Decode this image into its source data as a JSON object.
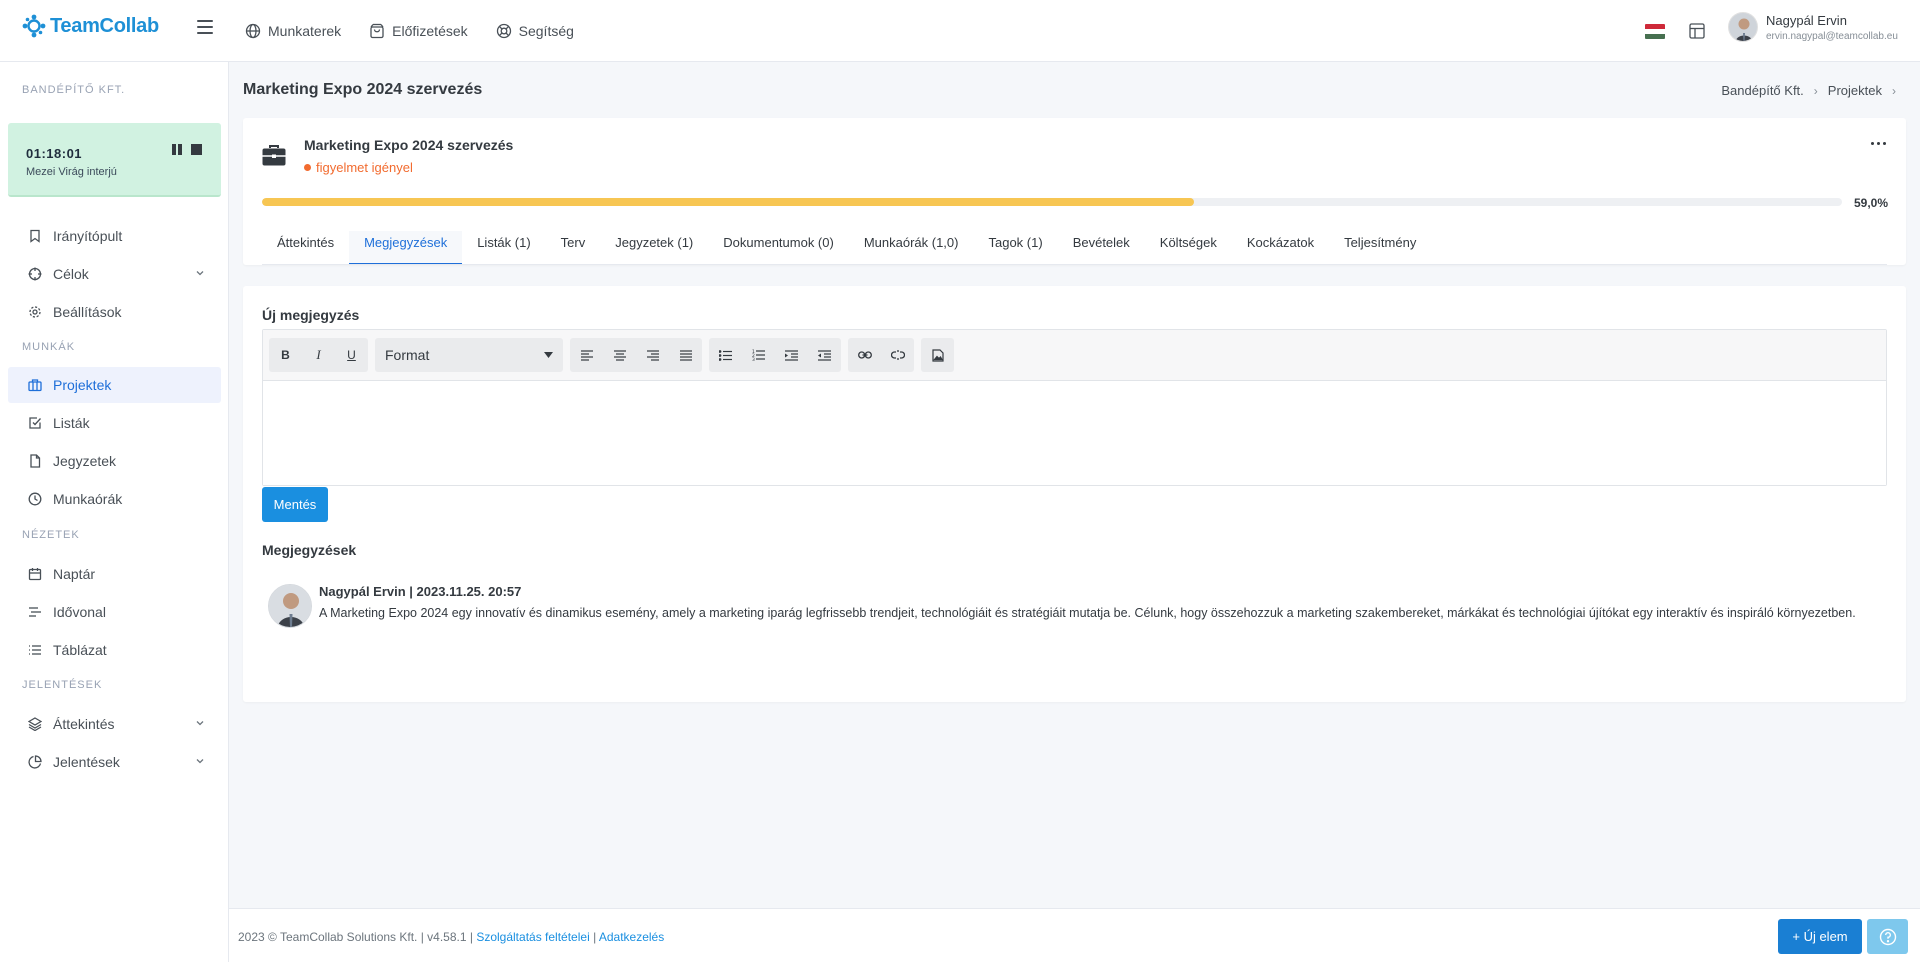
{
  "app": {
    "logo_text": "TeamCollab"
  },
  "topnav": {
    "items": [
      {
        "label": "Munkaterek",
        "icon": "globe-icon"
      },
      {
        "label": "Előfizetések",
        "icon": "shopping-bag-icon"
      },
      {
        "label": "Segítség",
        "icon": "lifebuoy-icon"
      }
    ]
  },
  "user": {
    "name": "Nagypál Ervin",
    "email": "ervin.nagypal@teamcollab.eu"
  },
  "sidebar": {
    "company": "BANDÉPÍTŐ KFT.",
    "timer": {
      "time": "01:18:01",
      "label": "Mezei Virág interjú"
    },
    "items": [
      {
        "label": "Irányítópult",
        "icon": "bookmark-icon"
      },
      {
        "label": "Célok",
        "icon": "crosshair-icon"
      },
      {
        "label": "Beállítások",
        "icon": "gear-icon"
      },
      {
        "label": "Projektek",
        "icon": "briefcase-icon"
      },
      {
        "label": "Listák",
        "icon": "checkbox-icon"
      },
      {
        "label": "Jegyzetek",
        "icon": "file-icon"
      },
      {
        "label": "Munkaórák",
        "icon": "clock-icon"
      },
      {
        "label": "Naptár",
        "icon": "calendar-icon"
      },
      {
        "label": "Idővonal",
        "icon": "timeline-icon"
      },
      {
        "label": "Táblázat",
        "icon": "list-icon"
      },
      {
        "label": "Áttekintés",
        "icon": "layers-icon"
      },
      {
        "label": "Jelentések",
        "icon": "pie-chart-icon"
      }
    ],
    "sections": {
      "munkak": "MUNKÁK",
      "nezetek": "NÉZETEK",
      "jelentesek": "JELENTÉSEK"
    }
  },
  "page": {
    "title": "Marketing Expo 2024 szervezés",
    "breadcrumb": [
      "Bandépítő Kft.",
      "Projektek"
    ]
  },
  "project": {
    "name": "Marketing Expo 2024 szervezés",
    "status": "figyelmet igényel",
    "status_color": "#f26b2f",
    "progress_fraction": 0.59,
    "progress_label": "59,0%",
    "progress_color": "#f7c653"
  },
  "tabs": [
    "Áttekintés",
    "Megjegyzések",
    "Listák (1)",
    "Terv",
    "Jegyzetek (1)",
    "Dokumentumok (0)",
    "Munkaórák (1,0)",
    "Tagok (1)",
    "Bevételek",
    "Költségek",
    "Kockázatok",
    "Teljesítmény"
  ],
  "active_tab": "Megjegyzések",
  "new_note": {
    "heading": "Új megjegyzés",
    "format_label": "Format",
    "save_label": "Mentés"
  },
  "notes": {
    "title": "Megjegyzések",
    "items": [
      {
        "header": "Nagypál Ervin | 2023.11.25. 20:57",
        "text": "A Marketing Expo 2024 egy innovatív és dinamikus esemény, amely a marketing iparág legfrissebb trendjeit, technológiáit és stratégiáit mutatja be. Célunk, hogy összehozzuk a marketing szakembereket, márkákat és technológiai újítókat egy interaktív és inspiráló környezetben."
      }
    ]
  },
  "footer": {
    "copyright": "2023 © TeamCollab Solutions Kft. | v4.58.1 | ",
    "terms": "Szolgáltatás feltételei",
    "separator": " | ",
    "privacy": "Adatkezelés"
  },
  "actions": {
    "new_item": "+ Új elem"
  },
  "colors": {
    "brand": "#1e90d6",
    "primary_button": "#1a8fe0",
    "timer_bg": "#d1f2e1",
    "active_nav": "#1e6fd9"
  }
}
